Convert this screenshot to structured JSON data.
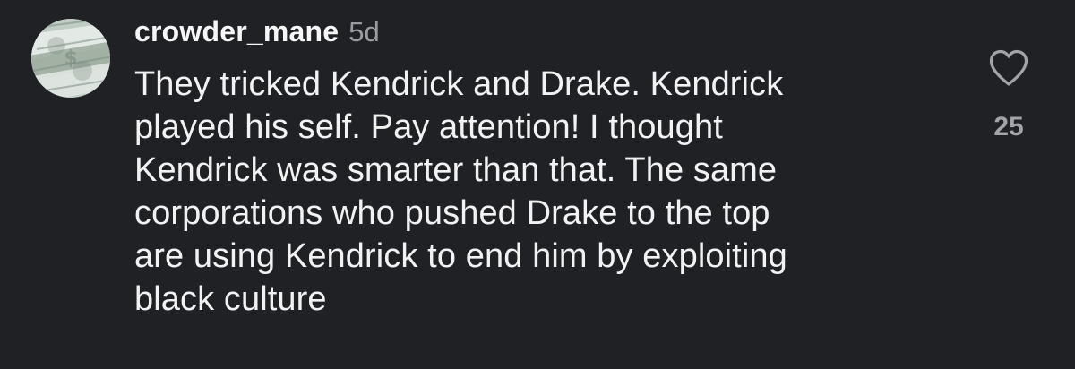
{
  "comment": {
    "avatar_icon": "money-avatar-icon",
    "username": "crowder_mane",
    "timestamp": "5d",
    "text_lines": [
      "They tricked Kendrick and Drake.  Kendrick",
      "played his self. Pay attention!  I thought",
      "Kendrick was smarter than that. The same",
      "corporations who pushed Drake to the top",
      "are using Kendrick to end him by exploiting",
      "black culture"
    ],
    "like_icon": "heart-icon",
    "like_count": "25"
  },
  "colors": {
    "background": "#202125",
    "primary_text": "#f2f2f3",
    "secondary_text": "#9b9ca2",
    "icon": "#a3a4a9"
  }
}
